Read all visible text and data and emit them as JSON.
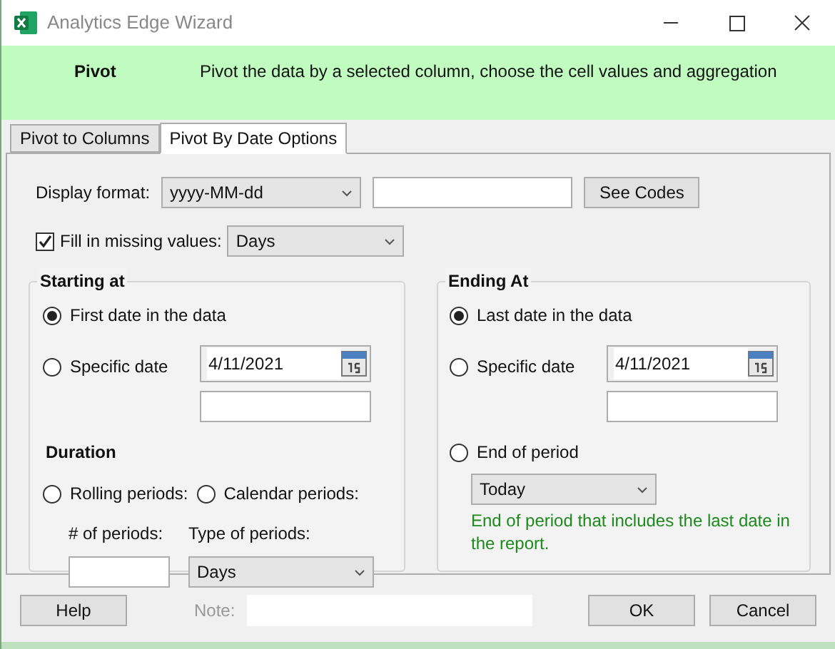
{
  "window": {
    "title": "Analytics Edge Wizard"
  },
  "header": {
    "title": "Pivot",
    "description": "Pivot the data by a selected column, choose the cell values and aggregation"
  },
  "tabs": [
    {
      "label": "Pivot to Columns",
      "selected": false
    },
    {
      "label": "Pivot By Date Options",
      "selected": true
    }
  ],
  "display_format": {
    "label": "Display format:",
    "value": "yyyy-MM-dd",
    "see_codes": "See Codes"
  },
  "fill_missing": {
    "label": "Fill in missing values:",
    "checked": true,
    "value": "Days"
  },
  "starting": {
    "title": "Starting at",
    "options": [
      {
        "label": "First date in the data",
        "selected": true
      },
      {
        "label": "Specific date",
        "selected": false
      }
    ],
    "date": "4/11/2021",
    "duration": {
      "title": "Duration",
      "options": [
        {
          "label": "Rolling periods:",
          "selected": false
        },
        {
          "label": "Calendar periods:",
          "selected": false
        }
      ],
      "periods_label": "# of periods:",
      "type_label": "Type of periods:",
      "type_value": "Days"
    }
  },
  "ending": {
    "title": "Ending At",
    "options": [
      {
        "label": "Last date in the data",
        "selected": true
      },
      {
        "label": "Specific date",
        "selected": false
      },
      {
        "label": "End of period",
        "selected": false
      }
    ],
    "date": "4/11/2021",
    "period_value": "Today",
    "hint": "End of period that includes the last date in the report."
  },
  "footer": {
    "help": "Help",
    "note_label": "Note:",
    "ok": "OK",
    "cancel": "Cancel"
  }
}
